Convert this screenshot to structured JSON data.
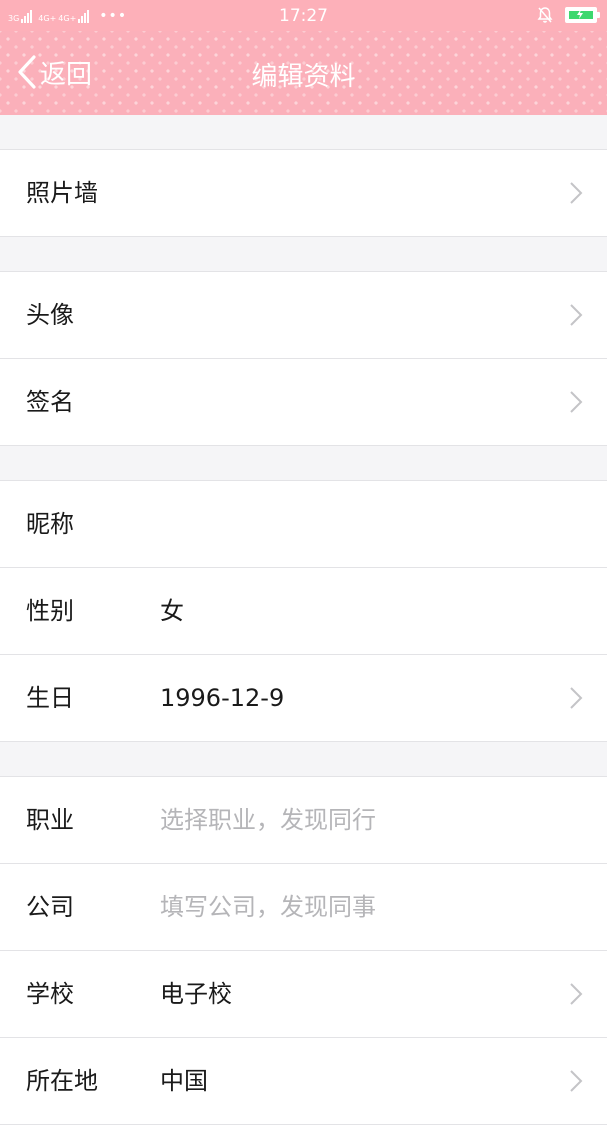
{
  "status_bar": {
    "sim1_label": "3G",
    "sim2_label": "4G+",
    "sim3_label": "4G+",
    "time": "17:27",
    "bell_icon": "bell-off-icon",
    "battery_icon": "battery-charging-icon"
  },
  "nav": {
    "back_label": "返回",
    "title": "编辑资料"
  },
  "groups": [
    [
      {
        "label": "照片墙",
        "value": "",
        "placeholder": false,
        "chevron": true
      }
    ],
    [
      {
        "label": "头像",
        "value": "",
        "placeholder": false,
        "chevron": true
      },
      {
        "label": "签名",
        "value": "",
        "placeholder": false,
        "chevron": true
      }
    ],
    [
      {
        "label": "昵称",
        "value": "",
        "placeholder": false,
        "chevron": false
      },
      {
        "label": "性别",
        "value": "女",
        "placeholder": false,
        "chevron": false
      },
      {
        "label": "生日",
        "value": "1996-12-9",
        "placeholder": false,
        "chevron": true
      }
    ],
    [
      {
        "label": "职业",
        "value": "选择职业，发现同行",
        "placeholder": true,
        "chevron": false
      },
      {
        "label": "公司",
        "value": "填写公司，发现同事",
        "placeholder": true,
        "chevron": false
      },
      {
        "label": "学校",
        "value": "电子校",
        "placeholder": false,
        "chevron": true
      },
      {
        "label": "所在地",
        "value": "中国",
        "placeholder": false,
        "chevron": true
      }
    ]
  ],
  "colors": {
    "header_pink": "#fbb0ba",
    "placeholder_gray": "#b5b5b8",
    "battery_green": "#3dd86e"
  }
}
